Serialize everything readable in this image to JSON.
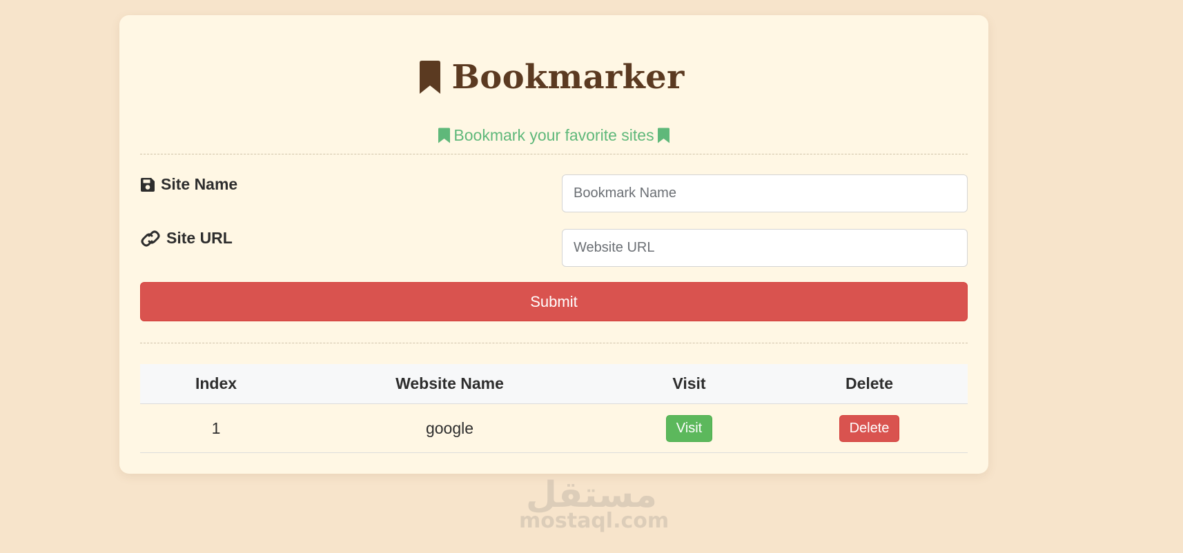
{
  "header": {
    "title": "Bookmarker",
    "subtitle": "Bookmark your favorite sites",
    "title_icon": "bookmark-icon",
    "subtitle_icon": "bookmark-icon"
  },
  "form": {
    "site_name": {
      "label": "Site Name",
      "icon": "floppy-disk-icon",
      "placeholder": "Bookmark Name",
      "value": ""
    },
    "site_url": {
      "label": "Site URL",
      "icon": "link-icon",
      "placeholder": "Website URL",
      "value": ""
    },
    "submit_label": "Submit"
  },
  "table": {
    "headers": {
      "index": "Index",
      "name": "Website Name",
      "visit": "Visit",
      "delete": "Delete"
    },
    "rows": [
      {
        "index": "1",
        "name": "google",
        "visit_label": "Visit",
        "delete_label": "Delete"
      }
    ]
  },
  "watermark": {
    "arabic": "مستقل",
    "latin": "mostaql.com"
  },
  "colors": {
    "page_background": "#f7e4cb",
    "card_background": "#fff7e4",
    "title": "#5b3a21",
    "subtitle": "#5fb87a",
    "danger": "#d9534f",
    "success": "#5cb85c"
  }
}
